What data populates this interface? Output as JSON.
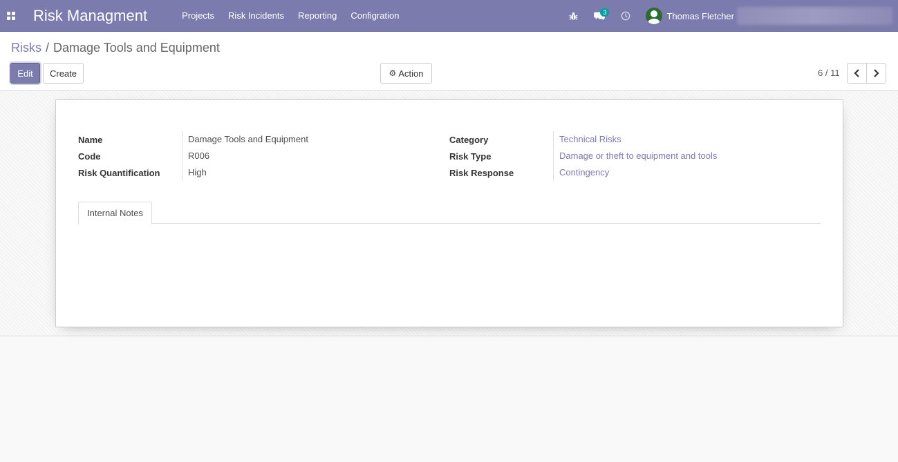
{
  "navbar": {
    "brand": "Risk Managment",
    "menu": [
      {
        "label": "Projects"
      },
      {
        "label": "Risk Incidents"
      },
      {
        "label": "Reporting"
      },
      {
        "label": "Configration"
      }
    ],
    "messages_count": "3",
    "user_name": "Thomas Fletcher"
  },
  "breadcrumb": {
    "parent": "Risks",
    "separator": "/",
    "current": "Damage Tools and Equipment"
  },
  "buttons": {
    "edit": "Edit",
    "create": "Create",
    "action": "Action"
  },
  "pager": {
    "value": "6 / 11"
  },
  "form": {
    "left": [
      {
        "label": "Name",
        "value": "Damage Tools and Equipment"
      },
      {
        "label": "Code",
        "value": "R006"
      },
      {
        "label": "Risk Quantification",
        "value": "High"
      }
    ],
    "right": [
      {
        "label": "Category",
        "value": "Technical Risks"
      },
      {
        "label": "Risk Type",
        "value": "Damage or theft to equipment and tools"
      },
      {
        "label": "Risk Response",
        "value": "Contingency"
      }
    ]
  },
  "tabs": [
    {
      "label": "Internal Notes"
    }
  ],
  "colors": {
    "brand": "#7c7bad",
    "badge": "#00a09d"
  }
}
